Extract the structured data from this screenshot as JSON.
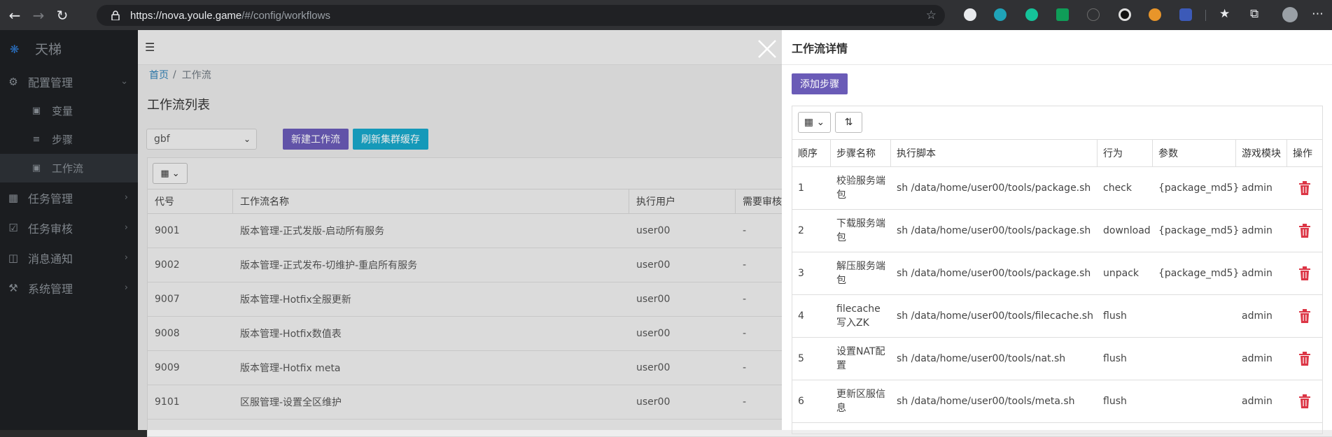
{
  "browser": {
    "url_host": "https://nova.youle.game",
    "url_path": "/#/config/workflows"
  },
  "sidebar": {
    "brand": "天梯",
    "menu": [
      {
        "label": "配置管理",
        "icon": "gears-icon"
      },
      {
        "label": "任务管理",
        "icon": "tasks-icon"
      },
      {
        "label": "任务审核",
        "icon": "check-square-icon"
      },
      {
        "label": "消息通知",
        "icon": "inbox-icon"
      },
      {
        "label": "系统管理",
        "icon": "wrench-icon"
      }
    ],
    "submenu": [
      {
        "label": "变量",
        "icon": "cube-icon"
      },
      {
        "label": "步骤",
        "icon": "steps-icon"
      },
      {
        "label": "工作流",
        "icon": "briefcase-icon"
      }
    ]
  },
  "main": {
    "breadcrumb_home": "首页",
    "breadcrumb_current": "工作流",
    "page_title": "工作流列表",
    "select_value": "gbf",
    "new_button": "新建工作流",
    "refresh_button": "刷新集群缓存",
    "columns": [
      "代号",
      "工作流名称",
      "执行用户",
      "需要审核的"
    ],
    "rows": [
      {
        "code": "9001",
        "name": "版本管理-正式发版-启动所有服务",
        "user": "user00",
        "review": "-"
      },
      {
        "code": "9002",
        "name": "版本管理-正式发布-切维护-重启所有服务",
        "user": "user00",
        "review": "-"
      },
      {
        "code": "9007",
        "name": "版本管理-Hotfix全服更新",
        "user": "user00",
        "review": "-"
      },
      {
        "code": "9008",
        "name": "版本管理-Hotfix数值表",
        "user": "user00",
        "review": "-"
      },
      {
        "code": "9009",
        "name": "版本管理-Hotfix meta",
        "user": "user00",
        "review": "-"
      },
      {
        "code": "9101",
        "name": "区服管理-设置全区维护",
        "user": "user00",
        "review": "-"
      }
    ]
  },
  "panel": {
    "title": "工作流详情",
    "add_button": "添加步骤",
    "columns": [
      "顺序",
      "步骤名称",
      "执行脚本",
      "行为",
      "参数",
      "游戏模块",
      "操作"
    ],
    "rows": [
      {
        "order": "1",
        "name": "校验服务端包",
        "script": "sh /data/home/user00/tools/package.sh",
        "action": "check",
        "params": "{package_md5}",
        "module": "admin"
      },
      {
        "order": "2",
        "name": "下载服务端包",
        "script": "sh /data/home/user00/tools/package.sh",
        "action": "download",
        "params": "{package_md5}",
        "module": "admin"
      },
      {
        "order": "3",
        "name": "解压服务端包",
        "script": "sh /data/home/user00/tools/package.sh",
        "action": "unpack",
        "params": "{package_md5}",
        "module": "admin"
      },
      {
        "order": "4",
        "name": "filecache 写入ZK",
        "script": "sh /data/home/user00/tools/filecache.sh",
        "action": "flush",
        "params": "",
        "module": "admin"
      },
      {
        "order": "5",
        "name": "设置NAT配置",
        "script": "sh /data/home/user00/tools/nat.sh",
        "action": "flush",
        "params": "",
        "module": "admin"
      },
      {
        "order": "6",
        "name": "更新区服信息",
        "script": "sh /data/home/user00/tools/meta.sh",
        "action": "flush",
        "params": "",
        "module": "admin"
      }
    ]
  },
  "colors": {
    "purple": "#6a5bb7",
    "cyan": "#17a7c9",
    "danger": "#dc3545",
    "link": "#2f7fb5"
  }
}
